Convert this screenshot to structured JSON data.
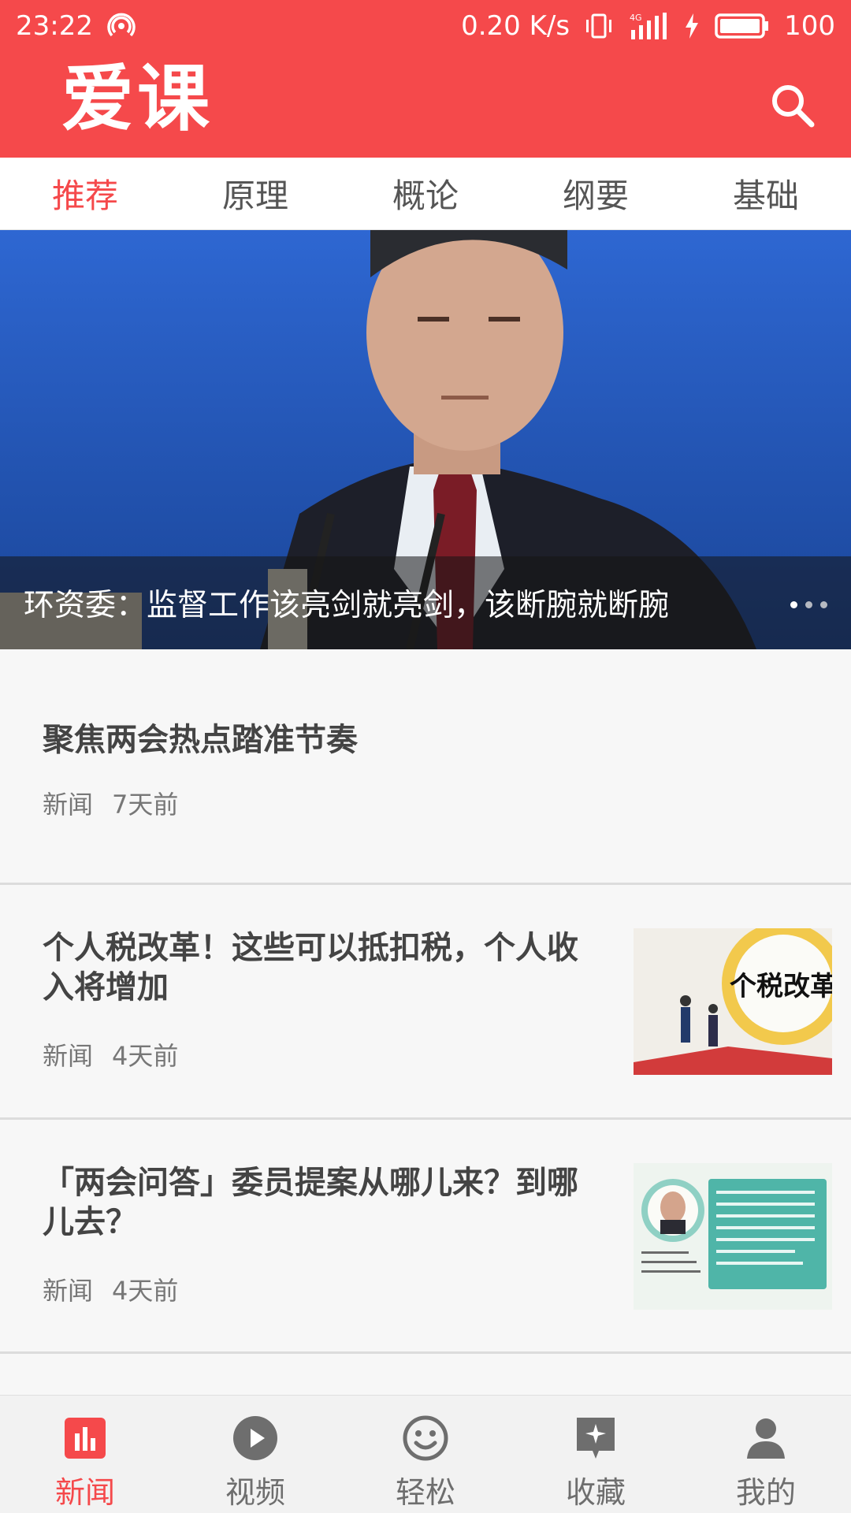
{
  "status_bar": {
    "time": "23:22",
    "network_speed": "0.20 K/s",
    "network_type": "4G",
    "battery": "100"
  },
  "header": {
    "app_title": "爱课",
    "search_icon": "search-icon"
  },
  "tabs": [
    {
      "label": "推荐",
      "active": true
    },
    {
      "label": "原理",
      "active": false
    },
    {
      "label": "概论",
      "active": false
    },
    {
      "label": "纲要",
      "active": false
    },
    {
      "label": "基础",
      "active": false
    }
  ],
  "hero": {
    "caption": "环资委：监督工作该亮剑就亮剑，该断腕就断腕"
  },
  "news": [
    {
      "title_line1": "聚焦两会热点踏准节奏",
      "title_line2": "",
      "category": "新闻",
      "time": "7天前"
    },
    {
      "title_line1": "个人税改革！这些可以抵扣税，个人收",
      "title_line2": "入将增加",
      "category": "新闻",
      "time": "4天前",
      "thumb_text": "个税改革"
    },
    {
      "title_line1": "「两会问答」委员提案从哪儿来？到哪",
      "title_line2": "儿去？",
      "category": "新闻",
      "time": "4天前"
    }
  ],
  "bottom_nav": [
    {
      "label": "新闻",
      "icon": "chart-icon",
      "active": true
    },
    {
      "label": "视频",
      "icon": "play-icon",
      "active": false
    },
    {
      "label": "轻松",
      "icon": "smile-icon",
      "active": false
    },
    {
      "label": "收藏",
      "icon": "star-icon",
      "active": false
    },
    {
      "label": "我的",
      "icon": "user-icon",
      "active": false
    }
  ],
  "colors": {
    "brand": "#f5494b",
    "text_dark": "#444444",
    "text_muted": "#777777"
  }
}
